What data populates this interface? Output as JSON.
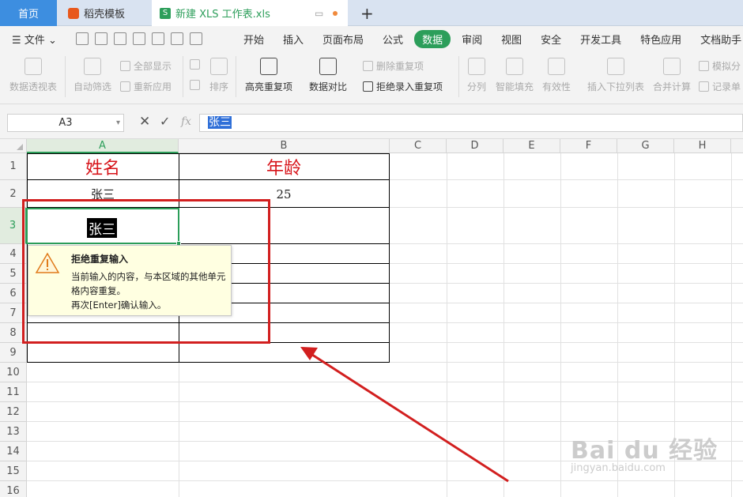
{
  "tabs": {
    "home": "首页",
    "template": "稻壳模板",
    "doc": "新建 XLS 工作表.xls",
    "add": "+",
    "xls_icon": "S"
  },
  "menu": {
    "file": "文件",
    "tabs": [
      "开始",
      "插入",
      "页面布局",
      "公式",
      "数据",
      "审阅",
      "视图",
      "安全",
      "开发工具",
      "特色应用",
      "文档助手"
    ],
    "active_tab": "数据"
  },
  "ribbon": {
    "pivot": "数据透视表",
    "auto_filter": "自动筛选",
    "show_all": "全部显示",
    "reapply": "重新应用",
    "sort": "排序",
    "highlight_dup": "高亮重复项",
    "data_compare": "数据对比",
    "delete_dup": "删除重复项",
    "reject_dup": "拒绝录入重复项",
    "split": "分列",
    "smart_fill": "智能填充",
    "validity": "有效性",
    "insert_dropdown": "插入下拉列表",
    "consolidate": "合并计算",
    "simulate": "模拟分",
    "record_sheet": "记录单"
  },
  "formula_bar": {
    "name_box": "A3",
    "cancel": "✕",
    "confirm": "✓",
    "fx": "fx",
    "value": "张三"
  },
  "columns": [
    "A",
    "B",
    "C",
    "D",
    "E",
    "F",
    "G",
    "H"
  ],
  "rows": [
    "1",
    "2",
    "3",
    "4",
    "5",
    "6",
    "7",
    "8",
    "9",
    "10",
    "11",
    "12",
    "13",
    "14",
    "15",
    "16"
  ],
  "cells": {
    "A1": "姓名",
    "B1": "年龄",
    "A2": "张三",
    "B2": "25",
    "A3": "张三"
  },
  "warning": {
    "title": "拒绝重复输入",
    "body_line1": "当前输入的内容，与本区域的其他单元格内容重复。",
    "body_line2": "再次[Enter]确认输入。"
  },
  "watermark": {
    "brand": "Bai du 经验",
    "url": "jingyan.baidu.com"
  },
  "colors": {
    "accent": "#2c9e5a",
    "header_text": "#d7141a",
    "highlight_box": "#d21f1f",
    "tab_home": "#3d8ee0"
  }
}
